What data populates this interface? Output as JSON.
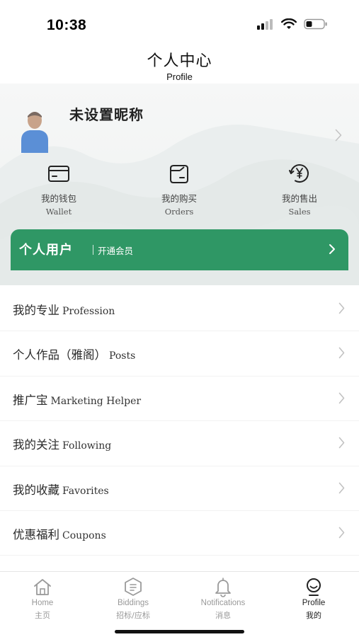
{
  "status_bar": {
    "time": "10:38"
  },
  "header": {
    "title": "个人中心",
    "subtitle": "Profile"
  },
  "profile": {
    "nickname": "未设置昵称"
  },
  "quick_actions": [
    {
      "cn": "我的钱包",
      "en": "Wallet",
      "icon": "wallet-icon"
    },
    {
      "cn": "我的购买",
      "en": "Orders",
      "icon": "orders-icon"
    },
    {
      "cn": "我的售出",
      "en": "Sales",
      "icon": "yen-icon"
    }
  ],
  "member_banner": {
    "title": "个人用户",
    "action": "开通会员"
  },
  "menu": [
    {
      "cn": "我的专业",
      "en": "Profession"
    },
    {
      "cn": "个人作品（雅阁）",
      "en": "Posts"
    },
    {
      "cn": "推广宝",
      "en": "Marketing Helper"
    },
    {
      "cn": "我的关注",
      "en": "Following"
    },
    {
      "cn": "我的收藏",
      "en": "Favorites"
    },
    {
      "cn": "优惠福利",
      "en": "Coupons"
    }
  ],
  "tabbar": [
    {
      "en": "Home",
      "cn": "主页",
      "icon": "home-icon",
      "active": false
    },
    {
      "en": "Biddings",
      "cn": "招标/应标",
      "icon": "bidding-icon",
      "active": false
    },
    {
      "en": "Notifications",
      "cn": "消息",
      "icon": "bell-icon",
      "active": false
    },
    {
      "en": "Profile",
      "cn": "我的",
      "icon": "profile-icon",
      "active": true
    }
  ],
  "colors": {
    "accent": "#2f9765",
    "avatar_body": "#5b8fd6",
    "avatar_head": "#c8a38a"
  }
}
